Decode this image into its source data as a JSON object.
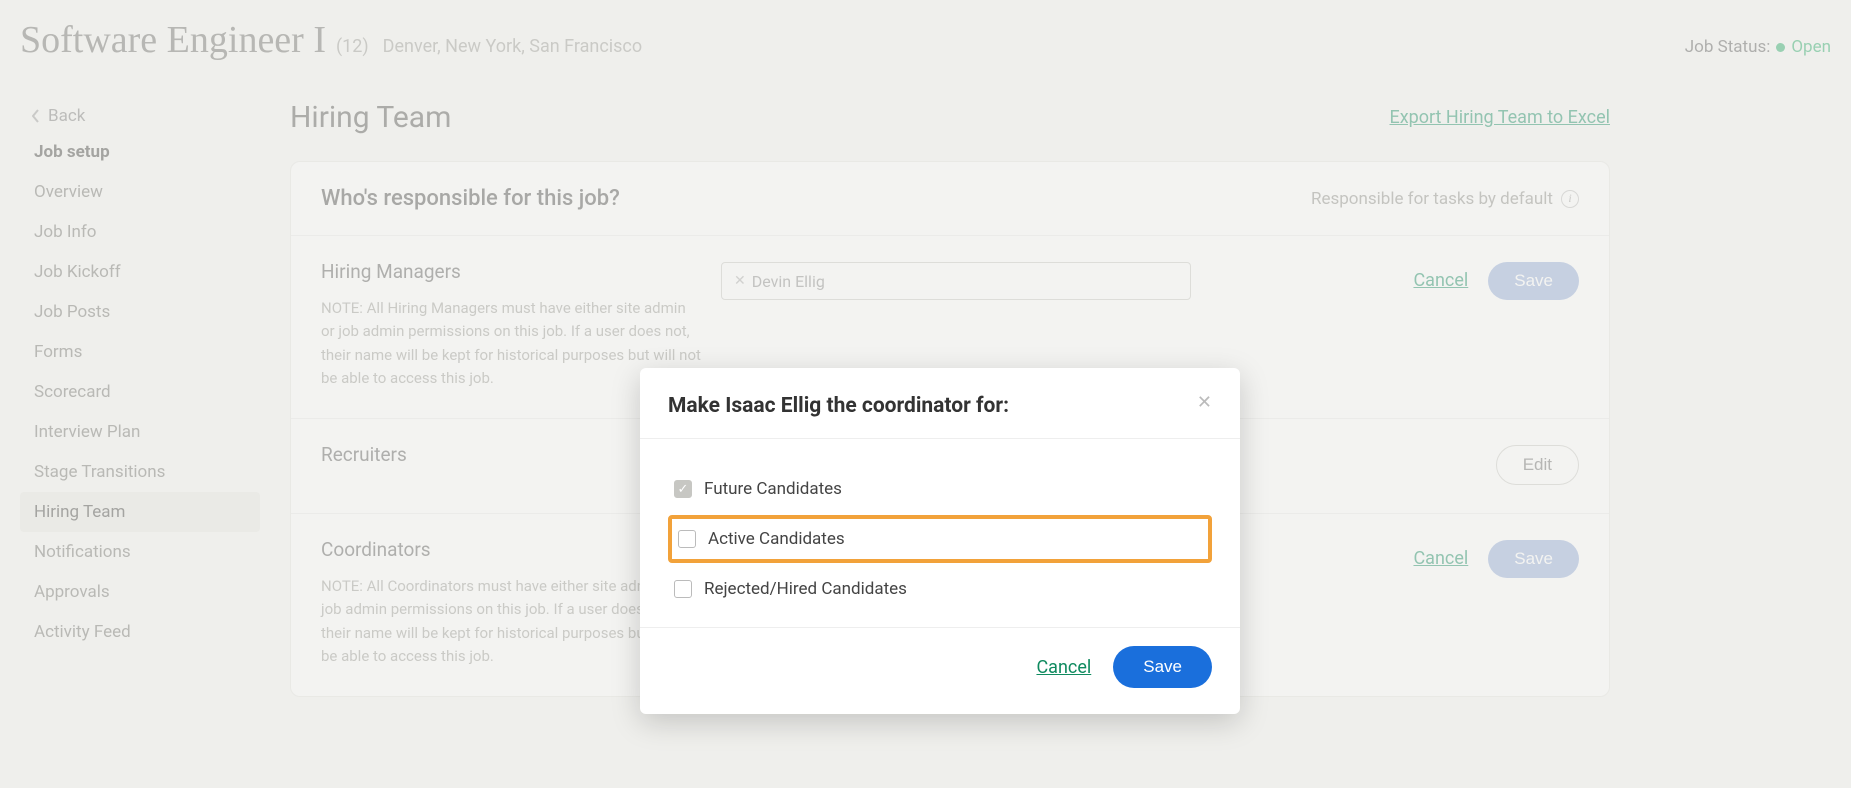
{
  "header": {
    "title": "Software Engineer I",
    "count": "(12)",
    "locations": "Denver, New York, San Francisco",
    "status_label": "Job Status:",
    "status_value": "Open"
  },
  "sidebar": {
    "back": "Back",
    "items": [
      {
        "label": "Job setup",
        "strong": true
      },
      {
        "label": "Overview"
      },
      {
        "label": "Job Info"
      },
      {
        "label": "Job Kickoff"
      },
      {
        "label": "Job Posts"
      },
      {
        "label": "Forms"
      },
      {
        "label": "Scorecard"
      },
      {
        "label": "Interview Plan"
      },
      {
        "label": "Stage Transitions"
      },
      {
        "label": "Hiring Team",
        "active": true
      },
      {
        "label": "Notifications"
      },
      {
        "label": "Approvals"
      },
      {
        "label": "Activity Feed"
      }
    ]
  },
  "main": {
    "title": "Hiring Team",
    "export": "Export Hiring Team to Excel",
    "panel_title": "Who's responsible for this job?",
    "panel_sub": "Responsible for tasks by default",
    "hm": {
      "title": "Hiring Managers",
      "note": "NOTE: All Hiring Managers must have either site admin or job admin permissions on this job. If a user does not, their name will be kept for historical purposes but will not be able to access this job.",
      "token": "Devin Ellig",
      "cancel": "Cancel",
      "save": "Save"
    },
    "rec": {
      "title": "Recruiters",
      "edit": "Edit"
    },
    "coord": {
      "title": "Coordinators",
      "note": "NOTE: All Coordinators must have either site admin or job admin permissions on this job. If a user does not, their name will be kept for historical purposes but will not be able to access this job.",
      "cancel": "Cancel",
      "save": "Save"
    }
  },
  "modal": {
    "title": "Make Isaac Ellig the coordinator for:",
    "options": {
      "future": "Future Candidates",
      "active": "Active Candidates",
      "rejected": "Rejected/Hired Candidates"
    },
    "cancel": "Cancel",
    "save": "Save"
  }
}
